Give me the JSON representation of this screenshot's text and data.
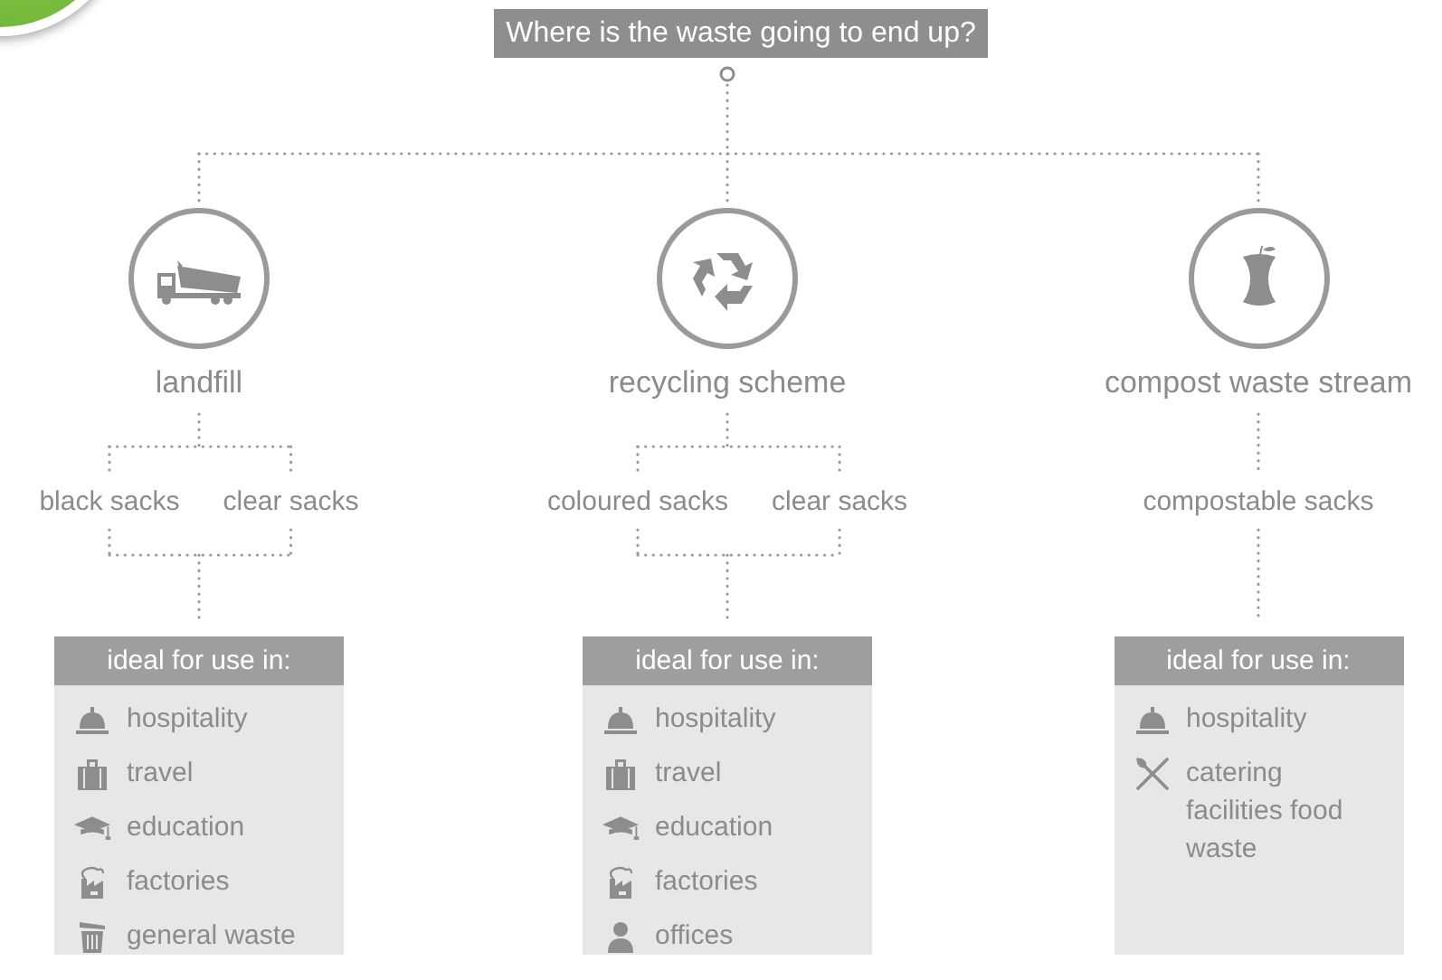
{
  "question": "Where is the waste going to end up?",
  "destinations": [
    {
      "label": "landfill",
      "kind": "truck",
      "sacks": [
        "black sacks",
        "clear sacks"
      ],
      "card": {
        "heading": "ideal for use in:",
        "items": [
          {
            "kind": "bell",
            "text": "hospitality"
          },
          {
            "kind": "suitcase",
            "text": "travel"
          },
          {
            "kind": "cap",
            "text": "education"
          },
          {
            "kind": "factory",
            "text": "factories"
          },
          {
            "kind": "bin",
            "text": "general waste"
          }
        ]
      }
    },
    {
      "label": "recycling scheme",
      "kind": "recycle",
      "sacks": [
        "coloured sacks",
        "clear sacks"
      ],
      "card": {
        "heading": "ideal for use in:",
        "items": [
          {
            "kind": "bell",
            "text": "hospitality"
          },
          {
            "kind": "suitcase",
            "text": "travel"
          },
          {
            "kind": "cap",
            "text": "education"
          },
          {
            "kind": "factory",
            "text": "factories"
          },
          {
            "kind": "person",
            "text": "offices"
          }
        ]
      }
    },
    {
      "label": "compost waste stream",
      "kind": "apple",
      "sacks": [
        "compostable sacks"
      ],
      "card": {
        "heading": "ideal for use in:",
        "items": [
          {
            "kind": "bell",
            "text": "hospitality"
          },
          {
            "kind": "cutlery",
            "text": "catering facilities food waste"
          }
        ]
      }
    }
  ]
}
